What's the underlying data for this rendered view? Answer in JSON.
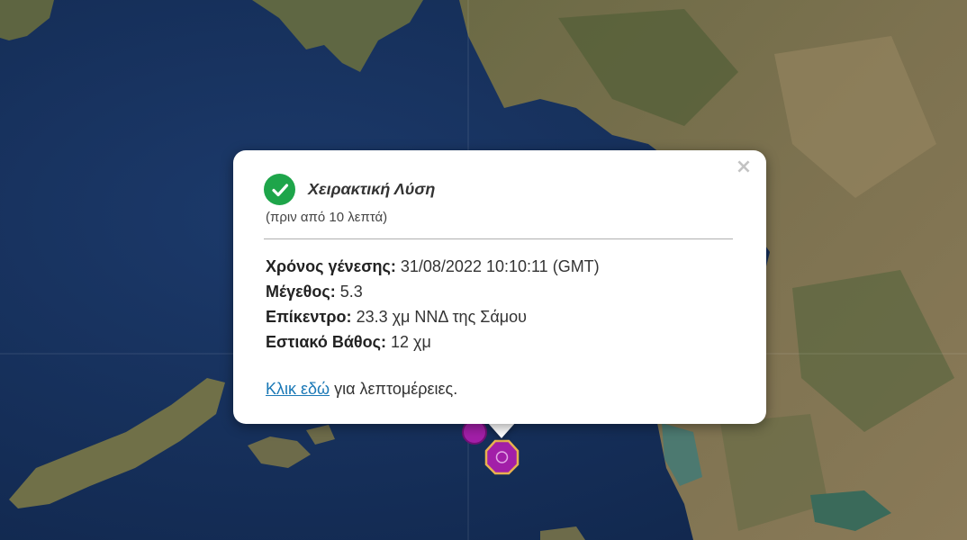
{
  "map": {
    "marker_color": "#a21fa8",
    "marker_outline": "#e8b14f"
  },
  "popup": {
    "close_symbol": "×",
    "status_icon": "check-circle-icon",
    "status_color": "#1ea54a",
    "solution_label": "Χειρακτική Λύση",
    "time_ago": "(πριν από 10 λεπτά)",
    "origin_time_label": "Χρόνος γένεσης:",
    "origin_time_value": "31/08/2022 10:10:11 (GMT)",
    "magnitude_label": "Μέγεθος:",
    "magnitude_value": "5.3",
    "epicenter_label": "Επίκεντρο:",
    "epicenter_value": "23.3 χμ ΝΝΔ της Σάμου",
    "depth_label": "Εστιακό Βάθος:",
    "depth_value": "12 χμ",
    "details_link": "Κλικ εδώ",
    "details_suffix": "για λεπτομέρειες."
  }
}
